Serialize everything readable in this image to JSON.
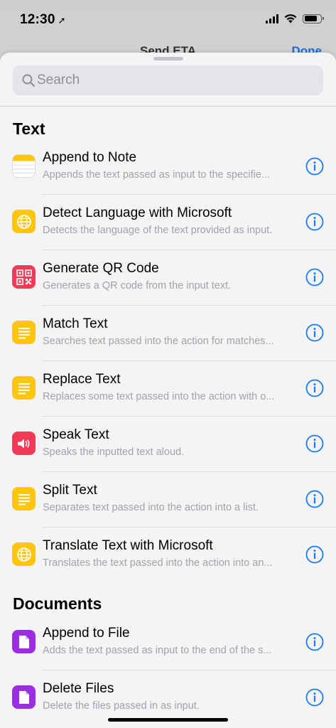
{
  "status_bar": {
    "time": "12:30",
    "location_glyph": "➚"
  },
  "background": {
    "nav_title": "Send ETA",
    "done_label": "Done"
  },
  "search": {
    "placeholder": "Search"
  },
  "sections": [
    {
      "title": "Text",
      "items": [
        {
          "title": "Append to Note",
          "subtitle": "Appends the text passed as input to the specifie...",
          "icon": "notes-icon"
        },
        {
          "title": "Detect Language with Microsoft",
          "subtitle": "Detects the language of the text provided as input.",
          "icon": "globe-icon"
        },
        {
          "title": "Generate QR Code",
          "subtitle": "Generates a QR code from the input text.",
          "icon": "qr-code-icon"
        },
        {
          "title": "Match Text",
          "subtitle": "Searches text passed into the action for matches...",
          "icon": "text-lines-icon"
        },
        {
          "title": "Replace Text",
          "subtitle": "Replaces some text passed into the action with o...",
          "icon": "text-lines-icon"
        },
        {
          "title": "Speak Text",
          "subtitle": "Speaks the inputted text aloud.",
          "icon": "speaker-icon"
        },
        {
          "title": "Split Text",
          "subtitle": "Separates text passed into the action into a list.",
          "icon": "text-lines-icon"
        },
        {
          "title": "Translate Text with Microsoft",
          "subtitle": "Translates the text passed into the action into an...",
          "icon": "globe-icon"
        }
      ]
    },
    {
      "title": "Documents",
      "items": [
        {
          "title": "Append to File",
          "subtitle": "Adds the text passed as input to the end of the s...",
          "icon": "document-icon"
        },
        {
          "title": "Delete Files",
          "subtitle": "Delete the files passed in as input.",
          "icon": "document-icon"
        }
      ]
    }
  ],
  "colors": {
    "accent_blue": "#1a7cf0",
    "yellow": "#fdc60a",
    "red": "#f23a56",
    "purple": "#9b2de3"
  }
}
